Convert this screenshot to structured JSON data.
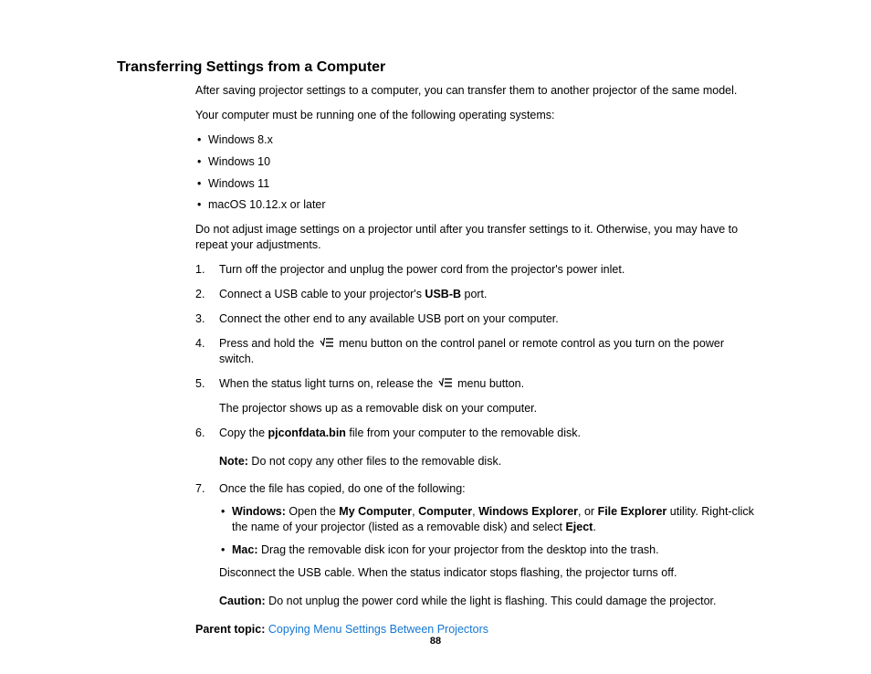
{
  "heading": "Transferring Settings from a Computer",
  "intro1": "After saving projector settings to a computer, you can transfer them to another projector of the same model.",
  "intro2": "Your computer must be running one of the following operating systems:",
  "os_list": [
    "Windows 8.x",
    "Windows 10",
    "Windows 11",
    "macOS 10.12.x or later"
  ],
  "warn": "Do not adjust image settings on a projector until after you transfer settings to it. Otherwise, you may have to repeat your adjustments.",
  "steps": {
    "s1": "Turn off the projector and unplug the power cord from the projector's power inlet.",
    "s2a": "Connect a USB cable to your projector's ",
    "s2b": "USB-B",
    "s2c": " port.",
    "s3": "Connect the other end to any available USB port on your computer.",
    "s4a": "Press and hold the ",
    "s4b": " menu button on the control panel or remote control as you turn on the power switch.",
    "s5a": "When the status light turns on, release the ",
    "s5b": " menu button.",
    "s5sub": "The projector shows up as a removable disk on your computer.",
    "s6a": "Copy the ",
    "s6b": "pjconfdata.bin",
    "s6c": " file from your computer to the removable disk.",
    "note_label": "Note:",
    "note_text": " Do not copy any other files to the removable disk.",
    "s7": "Once the file has copied, do one of the following:",
    "s7win_label": "Windows:",
    "s7win_a": " Open the ",
    "s7win_b": "My Computer",
    "s7win_c": ", ",
    "s7win_d": "Computer",
    "s7win_e": ", ",
    "s7win_f": "Windows Explorer",
    "s7win_g": ", or ",
    "s7win_h": "File Explorer",
    "s7win_i": " utility. Right-click the name of your projector (listed as a removable disk) and select ",
    "s7win_j": "Eject",
    "s7win_k": ".",
    "s7mac_label": "Mac:",
    "s7mac_text": " Drag the removable disk icon for your projector from the desktop into the trash.",
    "s7post": "Disconnect the USB cable. When the status indicator stops flashing, the projector turns off.",
    "caution_label": "Caution:",
    "caution_text": " Do not unplug the power cord while the light is flashing. This could damage the projector."
  },
  "parent_label": "Parent topic:",
  "parent_link": "Copying Menu Settings Between Projectors",
  "page_number": "88"
}
